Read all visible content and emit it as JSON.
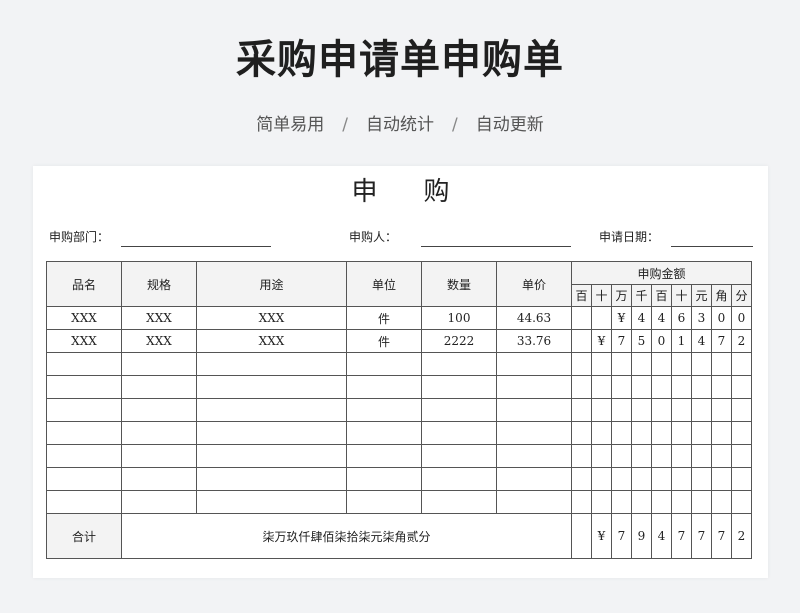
{
  "banner": {
    "title": "采购申请单申购单",
    "subtitle_items": [
      "简单易用",
      "自动统计",
      "自动更新"
    ],
    "separator": "/"
  },
  "form": {
    "heading": "申购",
    "fields": {
      "department_label": "申购部门：",
      "applicant_label": "申购人：",
      "date_label": "申请日期："
    },
    "columns": [
      "品名",
      "规格",
      "用途",
      "单位",
      "数量",
      "单价"
    ],
    "amount_header": "申购金额",
    "digit_headers": [
      "百",
      "十",
      "万",
      "千",
      "百",
      "十",
      "元",
      "角",
      "分"
    ],
    "rows": [
      {
        "name": "XXX",
        "spec": "XXX",
        "purpose": "XXX",
        "unit": "件",
        "qty": "100",
        "price": "44.63",
        "digits": [
          "",
          "",
          "¥",
          "4",
          "4",
          "6",
          "3",
          "0",
          "0"
        ]
      },
      {
        "name": "XXX",
        "spec": "XXX",
        "purpose": "XXX",
        "unit": "件",
        "qty": "2222",
        "price": "33.76",
        "digits": [
          "",
          "¥",
          "7",
          "5",
          "0",
          "1",
          "4",
          "7",
          "2"
        ]
      },
      {
        "name": "",
        "spec": "",
        "purpose": "",
        "unit": "",
        "qty": "",
        "price": "",
        "digits": [
          "",
          "",
          "",
          "",
          "",
          "",
          "",
          "",
          ""
        ]
      },
      {
        "name": "",
        "spec": "",
        "purpose": "",
        "unit": "",
        "qty": "",
        "price": "",
        "digits": [
          "",
          "",
          "",
          "",
          "",
          "",
          "",
          "",
          ""
        ]
      },
      {
        "name": "",
        "spec": "",
        "purpose": "",
        "unit": "",
        "qty": "",
        "price": "",
        "digits": [
          "",
          "",
          "",
          "",
          "",
          "",
          "",
          "",
          ""
        ]
      },
      {
        "name": "",
        "spec": "",
        "purpose": "",
        "unit": "",
        "qty": "",
        "price": "",
        "digits": [
          "",
          "",
          "",
          "",
          "",
          "",
          "",
          "",
          ""
        ]
      },
      {
        "name": "",
        "spec": "",
        "purpose": "",
        "unit": "",
        "qty": "",
        "price": "",
        "digits": [
          "",
          "",
          "",
          "",
          "",
          "",
          "",
          "",
          ""
        ]
      },
      {
        "name": "",
        "spec": "",
        "purpose": "",
        "unit": "",
        "qty": "",
        "price": "",
        "digits": [
          "",
          "",
          "",
          "",
          "",
          "",
          "",
          "",
          ""
        ]
      },
      {
        "name": "",
        "spec": "",
        "purpose": "",
        "unit": "",
        "qty": "",
        "price": "",
        "digits": [
          "",
          "",
          "",
          "",
          "",
          "",
          "",
          "",
          ""
        ]
      }
    ],
    "total": {
      "label": "合计",
      "amount_in_words": "柒万玖仟肆佰柒拾柒元柒角贰分",
      "digits": [
        "",
        "¥",
        "7",
        "9",
        "4",
        "7",
        "7",
        "7",
        "2"
      ]
    }
  }
}
